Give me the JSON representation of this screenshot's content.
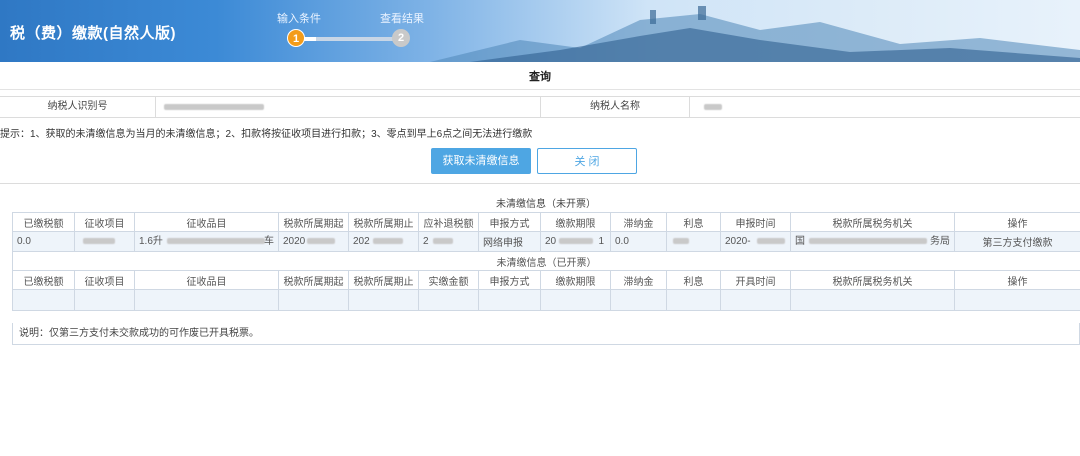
{
  "header": {
    "title": "税（费）缴款(自然人版)",
    "steps": [
      {
        "number": "1",
        "label": "输入条件",
        "active": true
      },
      {
        "number": "2",
        "label": "查看结果",
        "active": false
      }
    ],
    "colors": {
      "step_active": "#f39c1a",
      "step_inactive": "#c9c9c9"
    }
  },
  "query": {
    "title": "查询",
    "taxpayer_id_label": "纳税人识别号",
    "taxpayer_name_label": "纳税人名称",
    "tip": "提示：1、获取的未清缴信息为当月的未清缴信息；2、扣款将按征收项目进行扣款；3、零点到早上6点之间无法进行缴款",
    "fetch_button": "获取未清缴信息",
    "close_button": "关 闭",
    "colors": {
      "primary": "#4ea6e3"
    }
  },
  "unpaid_unissued": {
    "caption": "未清缴信息（未开票）",
    "columns": [
      "已缴税额",
      "征收项目",
      "征收品目",
      "税款所属期起",
      "税款所属期止",
      "应补退税额",
      "申报方式",
      "缴款期限",
      "滞纳金",
      "利息",
      "申报时间",
      "税款所属税务机关",
      "操作"
    ],
    "rows": [
      {
        "paid": "0.0",
        "item": "",
        "category": "1.6升",
        "category_suffix": "车",
        "period_start": "2020",
        "period_end": "202",
        "amount": "2",
        "method": "网络申报",
        "deadline": "20",
        "deadline_suffix": "1",
        "late_fee": "0.0",
        "interest": "",
        "declare_time": "2020-",
        "authority": "国",
        "authority_suffix": "务局",
        "action": "第三方支付缴款"
      }
    ],
    "colors": {
      "action": "#e2231a"
    }
  },
  "unpaid_issued": {
    "caption": "未清缴信息（已开票）",
    "columns": [
      "已缴税额",
      "征收项目",
      "征收品目",
      "税款所属期起",
      "税款所属期止",
      "实缴金额",
      "申报方式",
      "缴款期限",
      "滞纳金",
      "利息",
      "开具时间",
      "税款所属税务机关",
      "操作"
    ]
  },
  "note": "说明：仅第三方支付未交款成功的可作废已开具税票。"
}
